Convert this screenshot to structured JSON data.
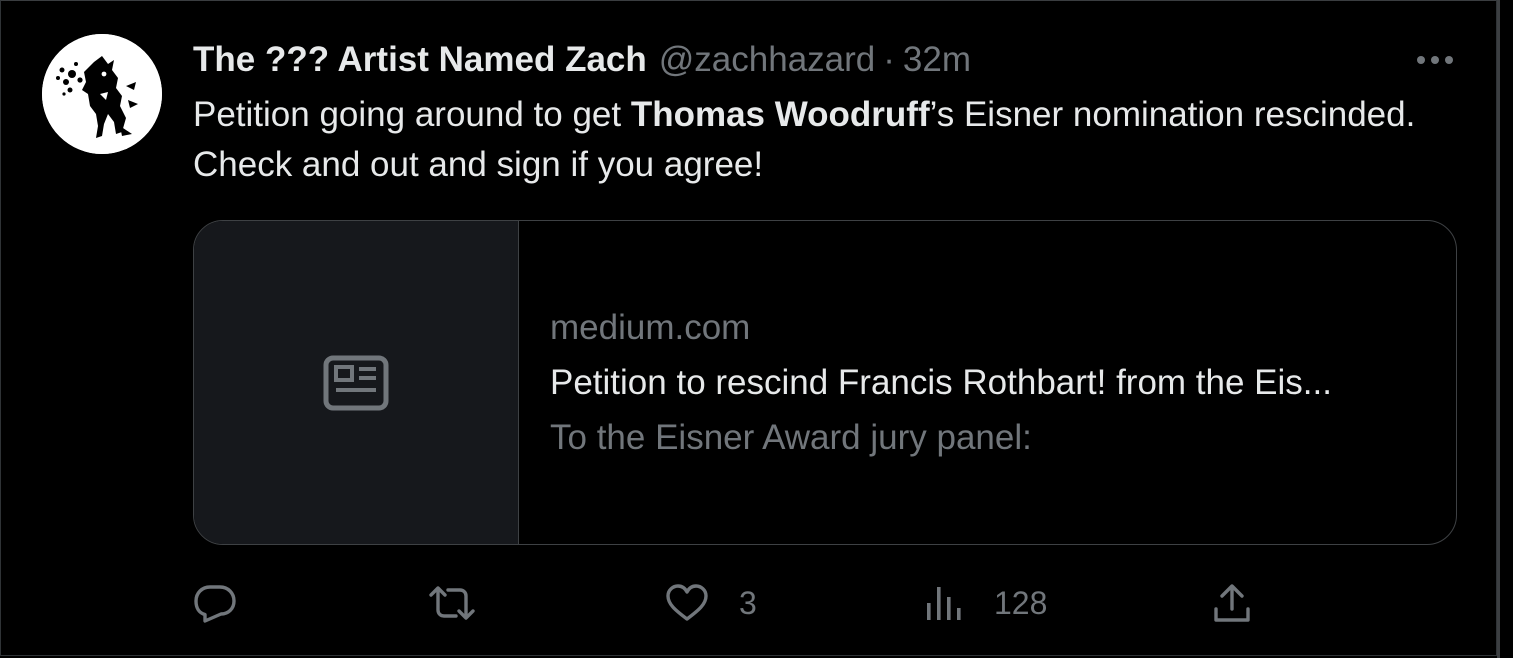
{
  "tweet": {
    "author": {
      "display_name": "The ??? Artist Named Zach",
      "handle": "@zachhazard"
    },
    "separator": "·",
    "timestamp": "32m",
    "text": {
      "part1": "Petition going around to get ",
      "bold": "Thomas Woodruff",
      "part2": "’s Eisner nomination rescinded. Check and out and sign if you agree!"
    },
    "card": {
      "domain": "medium.com",
      "title": "Petition to rescind Francis Rothbart! from the Eis...",
      "description": "To the Eisner Award jury panel:"
    },
    "actions": {
      "reply_count": "",
      "retweet_count": "",
      "like_count": "3",
      "views_count": "128"
    }
  },
  "icons": {
    "more": "more-horizontal-icon",
    "article": "article-icon",
    "reply": "reply-icon",
    "retweet": "retweet-icon",
    "like": "heart-icon",
    "views": "views-icon",
    "share": "share-icon"
  },
  "colors": {
    "background": "#000000",
    "text_primary": "#e7e9ea",
    "text_secondary": "#71767b",
    "border": "#3e4144",
    "thumb_bg": "#16181c"
  }
}
